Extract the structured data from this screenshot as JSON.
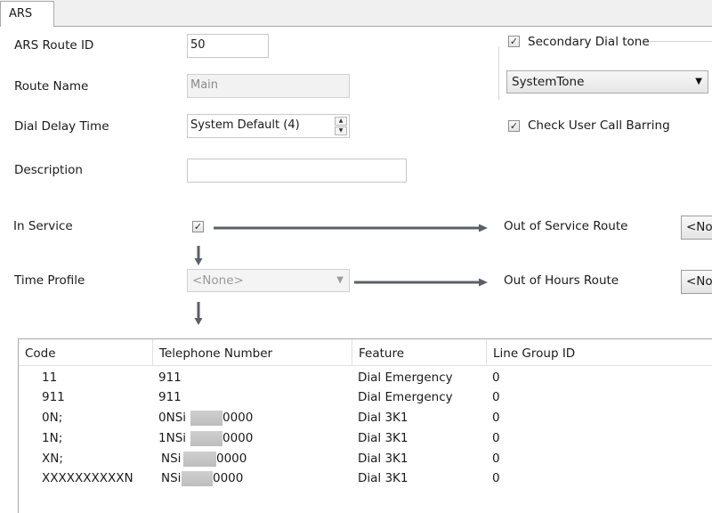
{
  "tab": {
    "label": "ARS"
  },
  "form": {
    "route_id": {
      "label": "ARS Route ID",
      "value": "50"
    },
    "route_name": {
      "label": "Route Name",
      "value": "Main"
    },
    "dial_delay": {
      "label": "Dial Delay Time",
      "value": "System Default (4)"
    },
    "description": {
      "label": "Description",
      "value": ""
    },
    "in_service": {
      "label": "In Service",
      "checked": true
    },
    "time_profile": {
      "label": "Time Profile",
      "value": "<None>"
    }
  },
  "secondary_dial_tone": {
    "label": "Secondary Dial tone",
    "checked": true,
    "value": "SystemTone"
  },
  "check_user_call_barring": {
    "label": "Check User Call Barring",
    "checked": true
  },
  "out_of_service_route": {
    "label": "Out of Service Route",
    "value": "<None>"
  },
  "out_of_hours_route": {
    "label": "Out of Hours Route",
    "value": "<None>"
  },
  "table": {
    "columns": [
      "Code",
      "Telephone Number",
      "Feature",
      "Line Group ID"
    ],
    "rows": [
      {
        "code": "11",
        "tel_prefix": "911",
        "tel_suffix": "",
        "feature": "Dial Emergency",
        "line_group": "0",
        "redacted": false
      },
      {
        "code": "911",
        "tel_prefix": "911",
        "tel_suffix": "",
        "feature": "Dial Emergency",
        "line_group": "0",
        "redacted": false
      },
      {
        "code": "0N;",
        "tel_prefix": "0NSi",
        "tel_suffix": "0000",
        "feature": "Dial 3K1",
        "line_group": "0",
        "redacted": true
      },
      {
        "code": "1N;",
        "tel_prefix": "1NSi",
        "tel_suffix": "0000",
        "feature": "Dial 3K1",
        "line_group": "0",
        "redacted": true
      },
      {
        "code": "XN;",
        "tel_prefix": "NSi",
        "tel_suffix": "0000",
        "feature": "Dial 3K1",
        "line_group": "0",
        "redacted": true
      },
      {
        "code": "XXXXXXXXXXN",
        "tel_prefix": "NSi",
        "tel_suffix": "0000",
        "feature": "Dial 3K1",
        "line_group": "0",
        "redacted": true
      }
    ]
  },
  "colors": {
    "arrow": "#5a6069",
    "border": "#a9a9a9"
  },
  "icons": {
    "check": "✓",
    "spin_up": "▲",
    "spin_down": "▼",
    "dropdown": "▼"
  }
}
